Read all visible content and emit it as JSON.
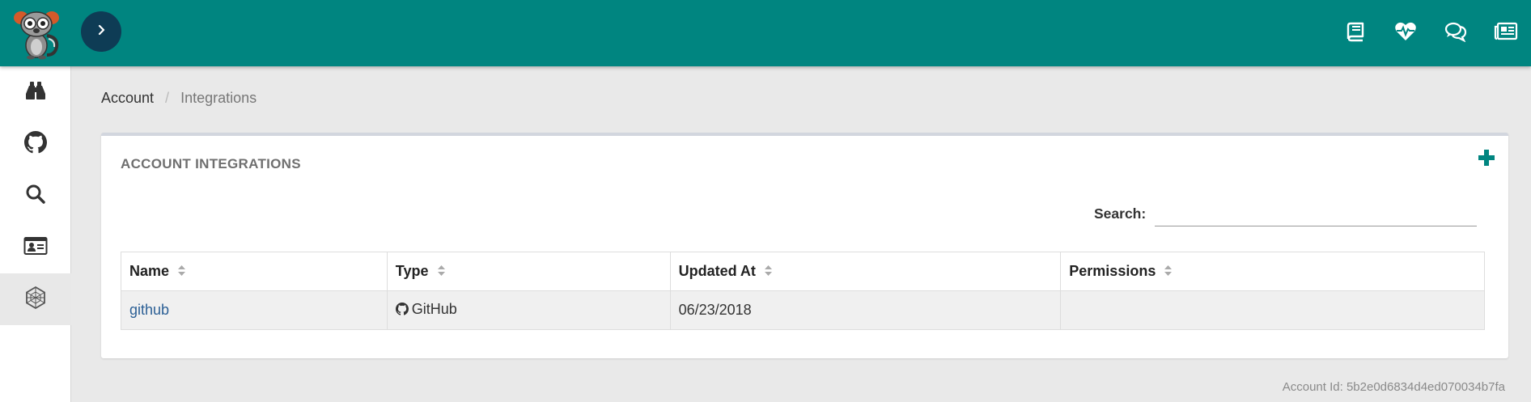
{
  "topbar": {
    "toggle_icon": "chevron-right-icon",
    "right_icons": [
      "book-icon",
      "heartbeat-icon",
      "comments-icon",
      "newspaper-icon"
    ]
  },
  "sidebar": {
    "items": [
      {
        "icon": "binoculars-icon"
      },
      {
        "icon": "github-icon"
      },
      {
        "icon": "search-icon"
      },
      {
        "icon": "id-card-icon"
      },
      {
        "icon": "integrations-icon",
        "active": true
      }
    ]
  },
  "breadcrumb": {
    "parent": "Account",
    "separator": "/",
    "current": "Integrations"
  },
  "panel": {
    "title": "ACCOUNT INTEGRATIONS",
    "add_icon": "plus-icon",
    "search_label": "Search:",
    "search_value": "",
    "columns": [
      "Name",
      "Type",
      "Updated At",
      "Permissions"
    ],
    "rows": [
      {
        "name": "github",
        "type": "GitHub",
        "type_icon": "github-icon",
        "updated_at": "06/23/2018",
        "permissions": ""
      }
    ]
  },
  "footer": {
    "account_id": "Account Id: 5b2e0d6834d4ed070034b7fa"
  },
  "colors": {
    "brand": "#008580",
    "toggle": "#0e3c55",
    "link": "#2b5f95"
  }
}
